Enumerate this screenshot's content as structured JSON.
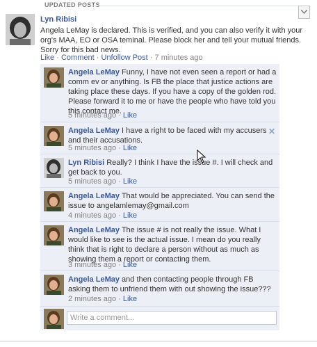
{
  "section": {
    "title": "UPDATED POSTS",
    "menu_icon": "chevron-down-icon"
  },
  "post": {
    "author": "Lyn Ribisi",
    "text": "Angela LeMay is declared. This is verified, and you can also verify it with your org's MAA, EO or OSA teminal. Please block her and tell your mutual friends. Sorry for this bad news.",
    "actions": {
      "like": "Like",
      "comment": "Comment",
      "unfollow": "Unfollow Post",
      "time": "7 minutes ago"
    }
  },
  "comments": [
    {
      "author": "Angela LeMay",
      "text": "Funny, I have not even seen a report or had a comm ev or anything. Is FB the place that justice actions are taking place these days. If you have a copy of the golden rod. Please forward it to me or have the people who have told you this contact me.",
      "time": "5 minutes ago",
      "like": "Like"
    },
    {
      "author": "Angela LeMay",
      "text": "I have a right to be faced with my accusers and their accusations.",
      "time": "5 minutes ago",
      "like": "Like",
      "close": "✕"
    },
    {
      "author": "Lyn Ribisi",
      "text": "Really? I think I have the issue #. I will check and get back to you.",
      "time": "5 minutes ago",
      "like": "Like"
    },
    {
      "author": "Angela LeMay",
      "text": "That would be appreciated. You can send the issue to angelamlemay@gmail.com",
      "time": "4 minutes ago",
      "like": "Like"
    },
    {
      "author": "Angela LeMay",
      "text": "The issue # is not really the issue. What I would like to see is the actual issue. I mean do you really think that is right to declare a person without as much as showing them a report or contacting them.",
      "time": "3 minutes ago",
      "like": "Like"
    },
    {
      "author": "Angela LeMay",
      "text": "and then contacting people through FB asking them to unfriend them with out showing the issue???",
      "time": "2 minutes ago",
      "like": "Like"
    }
  ],
  "write_comment": {
    "placeholder": "Write a comment..."
  },
  "colors": {
    "link": "#3b5998",
    "comment_bg": "#eceff5",
    "muted": "#808080"
  }
}
